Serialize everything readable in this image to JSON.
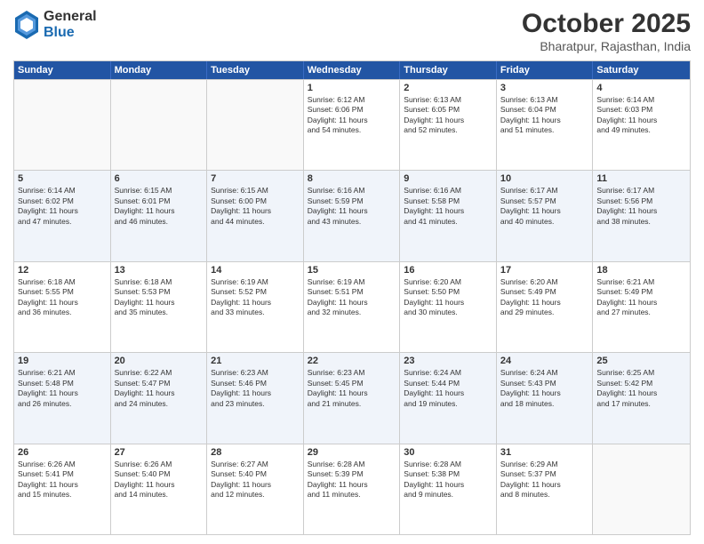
{
  "header": {
    "logo": {
      "general": "General",
      "blue": "Blue"
    },
    "month": "October 2025",
    "location": "Bharatpur, Rajasthan, India"
  },
  "weekdays": [
    "Sunday",
    "Monday",
    "Tuesday",
    "Wednesday",
    "Thursday",
    "Friday",
    "Saturday"
  ],
  "weeks": [
    [
      {
        "day": "",
        "empty": true,
        "info": ""
      },
      {
        "day": "",
        "empty": true,
        "info": ""
      },
      {
        "day": "",
        "empty": true,
        "info": ""
      },
      {
        "day": "1",
        "empty": false,
        "info": "Sunrise: 6:12 AM\nSunset: 6:06 PM\nDaylight: 11 hours\nand 54 minutes."
      },
      {
        "day": "2",
        "empty": false,
        "info": "Sunrise: 6:13 AM\nSunset: 6:05 PM\nDaylight: 11 hours\nand 52 minutes."
      },
      {
        "day": "3",
        "empty": false,
        "info": "Sunrise: 6:13 AM\nSunset: 6:04 PM\nDaylight: 11 hours\nand 51 minutes."
      },
      {
        "day": "4",
        "empty": false,
        "info": "Sunrise: 6:14 AM\nSunset: 6:03 PM\nDaylight: 11 hours\nand 49 minutes."
      }
    ],
    [
      {
        "day": "5",
        "empty": false,
        "info": "Sunrise: 6:14 AM\nSunset: 6:02 PM\nDaylight: 11 hours\nand 47 minutes."
      },
      {
        "day": "6",
        "empty": false,
        "info": "Sunrise: 6:15 AM\nSunset: 6:01 PM\nDaylight: 11 hours\nand 46 minutes."
      },
      {
        "day": "7",
        "empty": false,
        "info": "Sunrise: 6:15 AM\nSunset: 6:00 PM\nDaylight: 11 hours\nand 44 minutes."
      },
      {
        "day": "8",
        "empty": false,
        "info": "Sunrise: 6:16 AM\nSunset: 5:59 PM\nDaylight: 11 hours\nand 43 minutes."
      },
      {
        "day": "9",
        "empty": false,
        "info": "Sunrise: 6:16 AM\nSunset: 5:58 PM\nDaylight: 11 hours\nand 41 minutes."
      },
      {
        "day": "10",
        "empty": false,
        "info": "Sunrise: 6:17 AM\nSunset: 5:57 PM\nDaylight: 11 hours\nand 40 minutes."
      },
      {
        "day": "11",
        "empty": false,
        "info": "Sunrise: 6:17 AM\nSunset: 5:56 PM\nDaylight: 11 hours\nand 38 minutes."
      }
    ],
    [
      {
        "day": "12",
        "empty": false,
        "info": "Sunrise: 6:18 AM\nSunset: 5:55 PM\nDaylight: 11 hours\nand 36 minutes."
      },
      {
        "day": "13",
        "empty": false,
        "info": "Sunrise: 6:18 AM\nSunset: 5:53 PM\nDaylight: 11 hours\nand 35 minutes."
      },
      {
        "day": "14",
        "empty": false,
        "info": "Sunrise: 6:19 AM\nSunset: 5:52 PM\nDaylight: 11 hours\nand 33 minutes."
      },
      {
        "day": "15",
        "empty": false,
        "info": "Sunrise: 6:19 AM\nSunset: 5:51 PM\nDaylight: 11 hours\nand 32 minutes."
      },
      {
        "day": "16",
        "empty": false,
        "info": "Sunrise: 6:20 AM\nSunset: 5:50 PM\nDaylight: 11 hours\nand 30 minutes."
      },
      {
        "day": "17",
        "empty": false,
        "info": "Sunrise: 6:20 AM\nSunset: 5:49 PM\nDaylight: 11 hours\nand 29 minutes."
      },
      {
        "day": "18",
        "empty": false,
        "info": "Sunrise: 6:21 AM\nSunset: 5:49 PM\nDaylight: 11 hours\nand 27 minutes."
      }
    ],
    [
      {
        "day": "19",
        "empty": false,
        "info": "Sunrise: 6:21 AM\nSunset: 5:48 PM\nDaylight: 11 hours\nand 26 minutes."
      },
      {
        "day": "20",
        "empty": false,
        "info": "Sunrise: 6:22 AM\nSunset: 5:47 PM\nDaylight: 11 hours\nand 24 minutes."
      },
      {
        "day": "21",
        "empty": false,
        "info": "Sunrise: 6:23 AM\nSunset: 5:46 PM\nDaylight: 11 hours\nand 23 minutes."
      },
      {
        "day": "22",
        "empty": false,
        "info": "Sunrise: 6:23 AM\nSunset: 5:45 PM\nDaylight: 11 hours\nand 21 minutes."
      },
      {
        "day": "23",
        "empty": false,
        "info": "Sunrise: 6:24 AM\nSunset: 5:44 PM\nDaylight: 11 hours\nand 19 minutes."
      },
      {
        "day": "24",
        "empty": false,
        "info": "Sunrise: 6:24 AM\nSunset: 5:43 PM\nDaylight: 11 hours\nand 18 minutes."
      },
      {
        "day": "25",
        "empty": false,
        "info": "Sunrise: 6:25 AM\nSunset: 5:42 PM\nDaylight: 11 hours\nand 17 minutes."
      }
    ],
    [
      {
        "day": "26",
        "empty": false,
        "info": "Sunrise: 6:26 AM\nSunset: 5:41 PM\nDaylight: 11 hours\nand 15 minutes."
      },
      {
        "day": "27",
        "empty": false,
        "info": "Sunrise: 6:26 AM\nSunset: 5:40 PM\nDaylight: 11 hours\nand 14 minutes."
      },
      {
        "day": "28",
        "empty": false,
        "info": "Sunrise: 6:27 AM\nSunset: 5:40 PM\nDaylight: 11 hours\nand 12 minutes."
      },
      {
        "day": "29",
        "empty": false,
        "info": "Sunrise: 6:28 AM\nSunset: 5:39 PM\nDaylight: 11 hours\nand 11 minutes."
      },
      {
        "day": "30",
        "empty": false,
        "info": "Sunrise: 6:28 AM\nSunset: 5:38 PM\nDaylight: 11 hours\nand 9 minutes."
      },
      {
        "day": "31",
        "empty": false,
        "info": "Sunrise: 6:29 AM\nSunset: 5:37 PM\nDaylight: 11 hours\nand 8 minutes."
      },
      {
        "day": "",
        "empty": true,
        "info": ""
      }
    ]
  ]
}
